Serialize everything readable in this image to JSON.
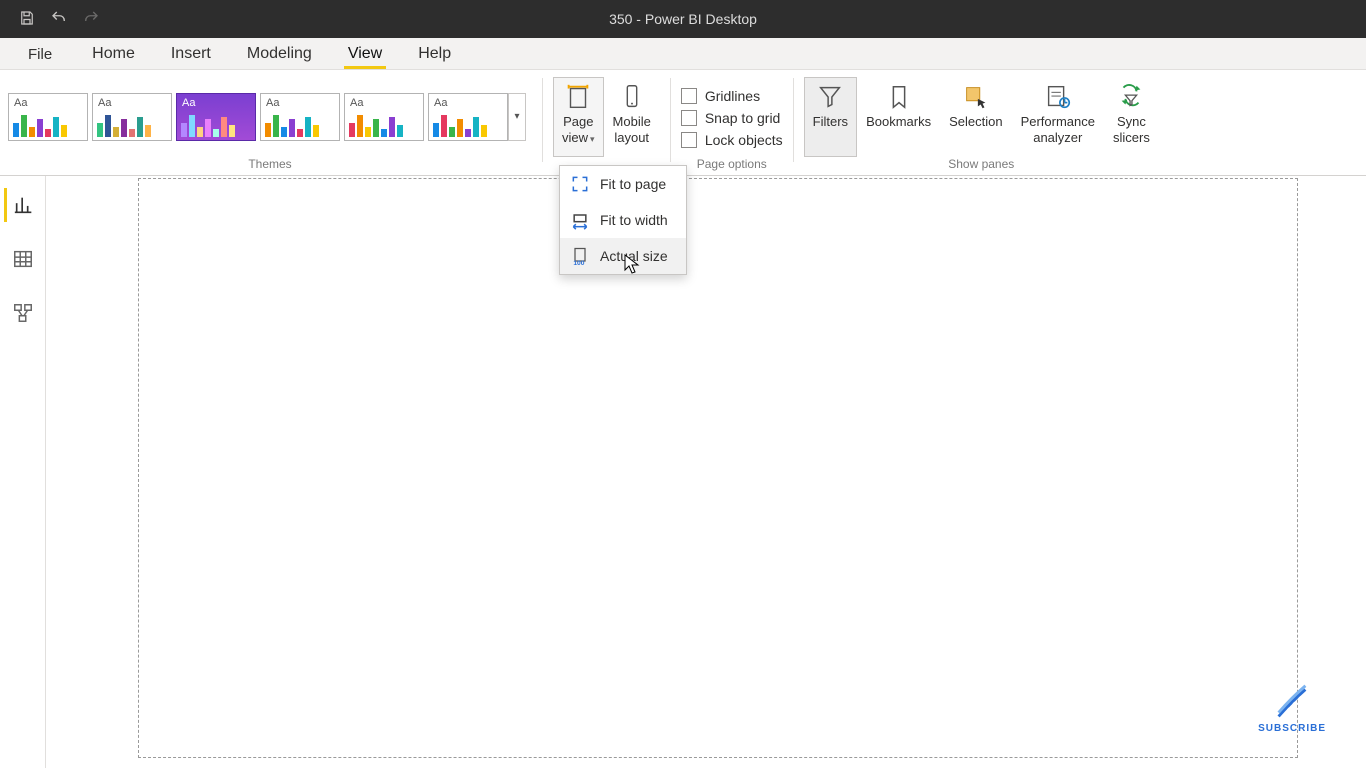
{
  "title": "350 - Power BI Desktop",
  "tabs": {
    "file": "File",
    "items": [
      "Home",
      "Insert",
      "Modeling",
      "View",
      "Help"
    ],
    "active_index": 3
  },
  "ribbon": {
    "themes_label": "Themes",
    "scale_label": "",
    "page_view": {
      "line1": "Page",
      "line2": "view"
    },
    "mobile_layout": {
      "line1": "Mobile",
      "line2": "layout"
    },
    "page_options_label": "Page options",
    "page_options": {
      "gridlines": "Gridlines",
      "snap": "Snap to grid",
      "lock": "Lock objects"
    },
    "show_panes_label": "Show panes",
    "panes": {
      "filters": "Filters",
      "bookmarks": "Bookmarks",
      "selection": "Selection",
      "performance": {
        "line1": "Performance",
        "line2": "analyzer"
      },
      "sync": {
        "line1": "Sync",
        "line2": "slicers"
      }
    }
  },
  "dropdown": {
    "fit_page": "Fit to page",
    "fit_width": "Fit to width",
    "actual_size": "Actual size"
  },
  "subscribe": "SUBSCRIBE",
  "theme_thumbs": [
    {
      "aa": "Aa",
      "selected": false,
      "colors": [
        "#168ae6",
        "#39b54a",
        "#f28c00",
        "#8a3fd1",
        "#e5395f",
        "#16b3c4",
        "#f9c802"
      ]
    },
    {
      "aa": "Aa",
      "selected": false,
      "colors": [
        "#33c481",
        "#2f5597",
        "#d4af37",
        "#862e9c",
        "#e17373",
        "#2a9d8f",
        "#ffb347"
      ]
    },
    {
      "aa": "Aa",
      "selected": true,
      "colors": [
        "#b388ff",
        "#80d8ff",
        "#ffd180",
        "#ea80fc",
        "#a7ffeb",
        "#ff8a80",
        "#ffe57f"
      ]
    },
    {
      "aa": "Aa",
      "selected": false,
      "colors": [
        "#f28c00",
        "#39b54a",
        "#168ae6",
        "#8a3fd1",
        "#e5395f",
        "#16b3c4",
        "#f9c802"
      ]
    },
    {
      "aa": "Aa",
      "selected": false,
      "colors": [
        "#e5395f",
        "#f28c00",
        "#f9c802",
        "#39b54a",
        "#168ae6",
        "#8a3fd1",
        "#16b3c4"
      ]
    },
    {
      "aa": "Aa",
      "selected": false,
      "colors": [
        "#168ae6",
        "#e5395f",
        "#39b54a",
        "#f28c00",
        "#8a3fd1",
        "#16b3c4",
        "#f9c802"
      ]
    }
  ],
  "theme_bar_heights": [
    14,
    22,
    10,
    18,
    8,
    20,
    12
  ]
}
